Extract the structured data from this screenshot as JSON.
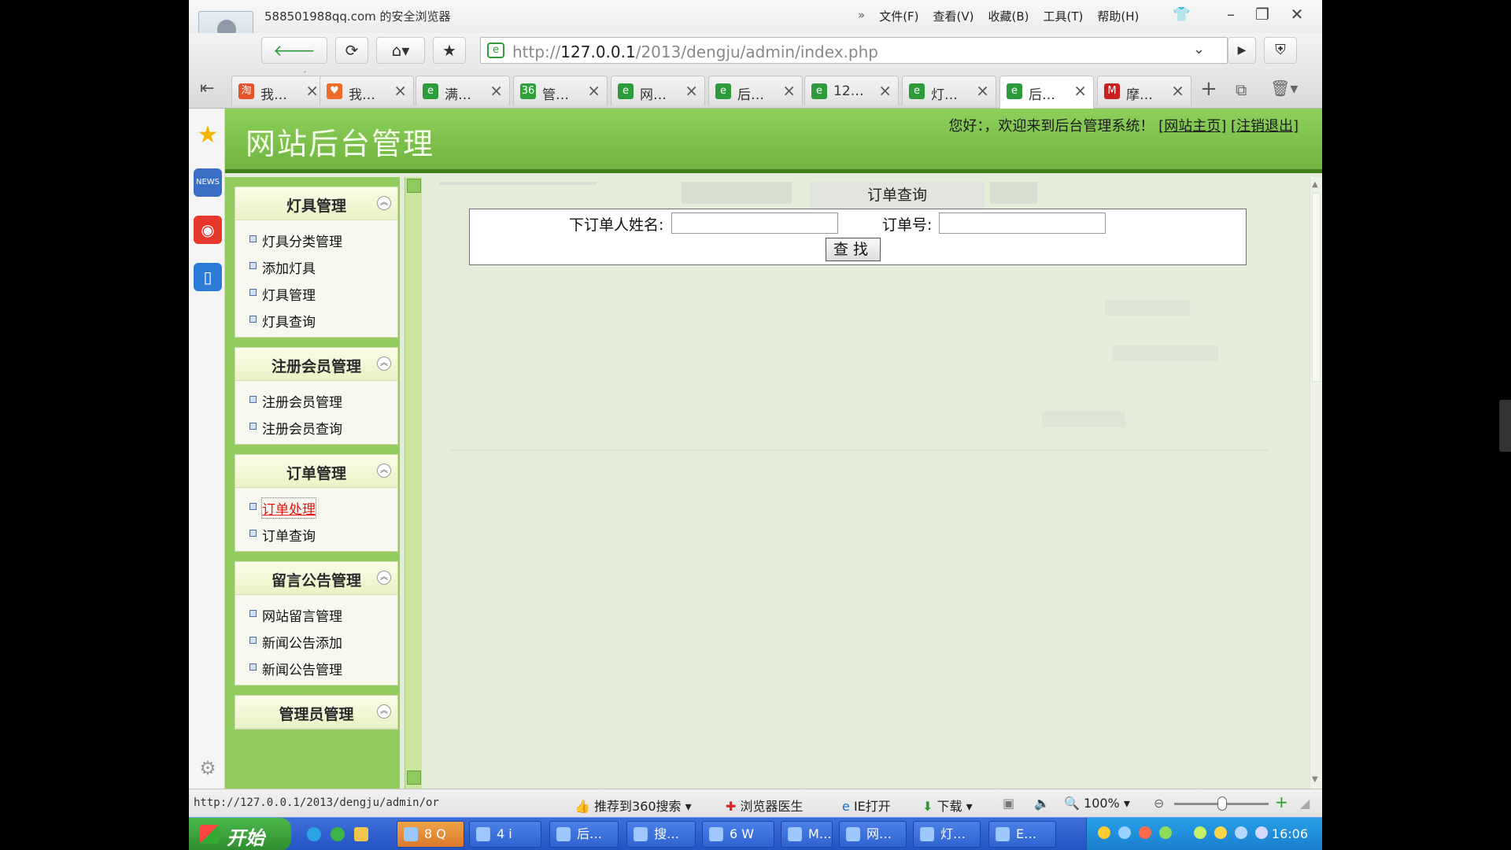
{
  "window": {
    "title": "588501988qq.com 的安全浏览器",
    "menu": [
      "文件(F)",
      "查看(V)",
      "收藏(B)",
      "工具(T)",
      "帮助(H)"
    ],
    "menu_more": "»",
    "controls": [
      "–",
      "❐",
      "✕"
    ]
  },
  "toolbar": {
    "url_prefix": "http://",
    "url_host": "127.0.0.1",
    "url_path": "/2013/dengju/admin/index.php"
  },
  "tabs": [
    {
      "label": "我…",
      "icon": "淘",
      "color": "#e4532b"
    },
    {
      "label": "我…",
      "icon": "♥",
      "color": "#ef6b2a"
    },
    {
      "label": "满…",
      "icon": "e",
      "color": "#2d9b3c"
    },
    {
      "label": "管…",
      "icon": "36",
      "color": "#2fa13a"
    },
    {
      "label": "网…",
      "icon": "e",
      "color": "#2d9b3c"
    },
    {
      "label": "后…",
      "icon": "e",
      "color": "#2d9b3c"
    },
    {
      "label": "12…",
      "icon": "e",
      "color": "#2d9b3c"
    },
    {
      "label": "灯…",
      "icon": "e",
      "color": "#2d9b3c"
    },
    {
      "label": "后…",
      "icon": "e",
      "color": "#2d9b3c",
      "active": true
    },
    {
      "label": "摩…",
      "icon": "M",
      "color": "#cc1f1f"
    }
  ],
  "site": {
    "title": "网站后台管理",
    "welcome": "您好：，欢迎来到后台管理系统！",
    "home_link": "[网站主页]",
    "logout_link": "[注销退出]"
  },
  "menu_groups": [
    {
      "title": "灯具管理",
      "items": [
        "灯具分类管理",
        "添加灯具",
        "灯具管理",
        "灯具查询"
      ]
    },
    {
      "title": "注册会员管理",
      "items": [
        "注册会员管理",
        "注册会员查询"
      ]
    },
    {
      "title": "订单管理",
      "items": [
        "订单处理",
        "订单查询"
      ],
      "active_index": 0
    },
    {
      "title": "留言公告管理",
      "items": [
        "网站留言管理",
        "新闻公告添加",
        "新闻公告管理"
      ]
    },
    {
      "title": "管理员管理",
      "items": []
    }
  ],
  "order_search": {
    "tab_label": "订单查询",
    "name_label": "下订单人姓名:",
    "name_value": "",
    "order_label": "订单号:",
    "order_value": "",
    "submit_label": "查找"
  },
  "statusbar": {
    "url": "http://127.0.0.1/2013/dengju/admin/or",
    "search_360": "推荐到360搜索",
    "doctor": "浏览器医生",
    "ie_open": "IE打开",
    "download": "下载",
    "zoom": "100%"
  },
  "taskbar": {
    "start": "开始",
    "items": [
      "8 Q",
      "4 i",
      "后…",
      "搜…",
      "6 W",
      "M…",
      "网…",
      "灯…",
      "E…"
    ],
    "clock": "16:06"
  },
  "colors": {
    "header_green": "#7fc24c",
    "menu_green": "#92cb5e",
    "active_link": "#e11111"
  }
}
